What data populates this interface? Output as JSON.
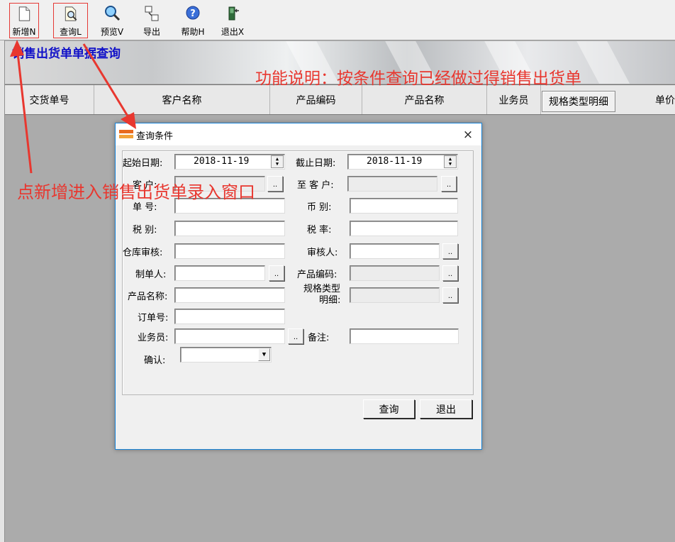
{
  "toolbar": {
    "buttons": [
      {
        "label": "新增N",
        "icon": "new-document-icon"
      },
      {
        "label": "查询L",
        "icon": "magnifier-document-icon"
      },
      {
        "label": "预览V",
        "icon": "magnifier-icon"
      },
      {
        "label": "导出",
        "icon": "export-icon"
      },
      {
        "label": "帮助H",
        "icon": "help-icon"
      },
      {
        "label": "退出X",
        "icon": "exit-door-icon"
      }
    ]
  },
  "banner": {
    "title": "销售出货单单据查询"
  },
  "grid": {
    "columns": [
      "交货单号",
      "客户名称",
      "产品编码",
      "产品名称",
      "业务员",
      "规格类型明细",
      "单价"
    ]
  },
  "annotations": {
    "function_note": "功能说明：按条件查询已经做过得销售出货单",
    "new_note": "点新增进入销售出货单录入窗口"
  },
  "dialog": {
    "title": "查询条件",
    "close": "×",
    "fields": {
      "start_date_label": "起始日期:",
      "start_date_value": "2018-11-19",
      "end_date_label": "截止日期:",
      "end_date_value": "2018-11-19",
      "customer_label": "客  户:",
      "to_customer_label": "至 客 户:",
      "doc_no_label": "单  号:",
      "currency_label": "币  别:",
      "tax_type_label": "税  别:",
      "tax_rate_label": "税  率:",
      "warehouse_audit_label": "仓库审核:",
      "auditor_label": "审核人:",
      "creator_label": "制单人:",
      "product_code_label": "产品编码:",
      "product_name_label": "产品名称:",
      "spec_type_label_1": "规格类型",
      "spec_type_label_2": "明细:",
      "order_no_label": "订单号:",
      "salesman_label": "业务员:",
      "remark_label": "备注:",
      "confirm_label": "确认:"
    },
    "dots_label": "..",
    "query_button": "查询",
    "exit_button": "退出"
  },
  "colors": {
    "annotation": "#e8372f",
    "banner_title": "#1010c8",
    "dialog_border": "#1883d7",
    "background": "#ababab"
  }
}
